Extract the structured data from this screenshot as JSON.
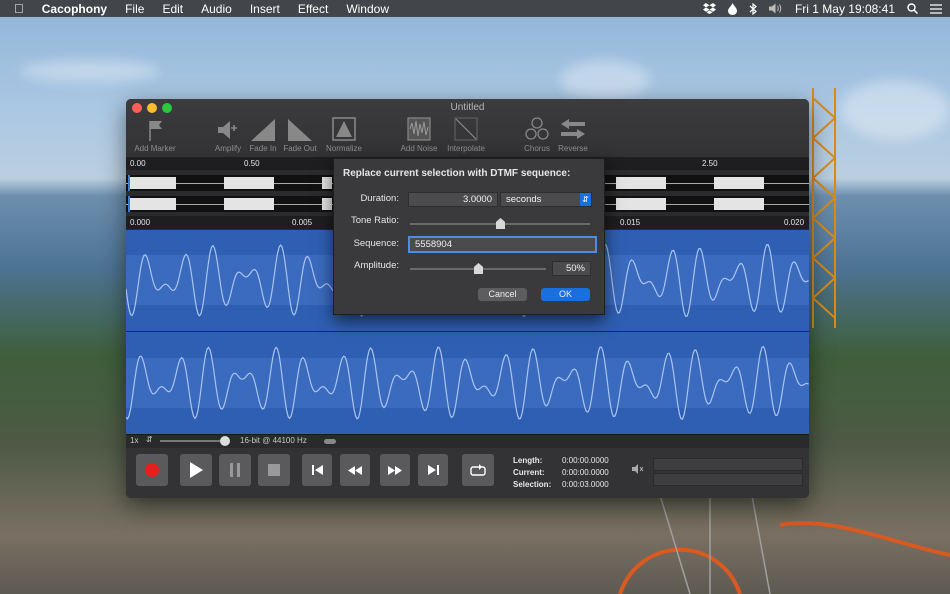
{
  "menubar": {
    "app_name": "Cacophony",
    "items": [
      "File",
      "Edit",
      "Audio",
      "Insert",
      "Effect",
      "Window"
    ],
    "clock": "Fri 1 May  19:08:41"
  },
  "window": {
    "title": "Untitled",
    "toolbar": [
      {
        "label": "Add Marker",
        "icon": "flag-icon"
      },
      {
        "label": "Amplify",
        "icon": "speaker-plus-icon"
      },
      {
        "label": "Fade In",
        "icon": "fade-in-icon"
      },
      {
        "label": "Fade Out",
        "icon": "fade-out-icon"
      },
      {
        "label": "Normalize",
        "icon": "normalize-icon"
      },
      {
        "label": "Add Noise",
        "icon": "noise-icon"
      },
      {
        "label": "Interpolate",
        "icon": "interpolate-icon"
      },
      {
        "label": "Chorus",
        "icon": "chorus-icon"
      },
      {
        "label": "Reverse",
        "icon": "reverse-icon"
      }
    ],
    "overview_ruler": [
      "0.00",
      "0.50",
      "2.50"
    ],
    "detail_ruler": [
      "0.000",
      "0.005",
      "0.015",
      "0.020"
    ],
    "status": {
      "zoom": "1x",
      "format": "16-bit @ 44100 Hz"
    },
    "transport": {
      "length_label": "Length:",
      "length_value": "0:00:00.0000",
      "current_label": "Current:",
      "current_value": "0:00:00.0000",
      "selection_label": "Selection:",
      "selection_value": "0:00:03.0000"
    }
  },
  "dialog": {
    "title": "Replace current selection with DTMF sequence:",
    "duration_label": "Duration:",
    "duration_value": "3.0000",
    "duration_unit": "seconds",
    "tone_ratio_label": "Tone Ratio:",
    "tone_ratio": 0.5,
    "sequence_label": "Sequence:",
    "sequence_value": "5558904",
    "amplitude_label": "Amplitude:",
    "amplitude_value": "50%",
    "amplitude": 0.5,
    "cancel_label": "Cancel",
    "ok_label": "OK"
  },
  "colors": {
    "accent": "#1a6fe0",
    "record": "#e8201d",
    "waveform_bg": "#2f5fb3",
    "waveform_line": "#aac4ee"
  }
}
